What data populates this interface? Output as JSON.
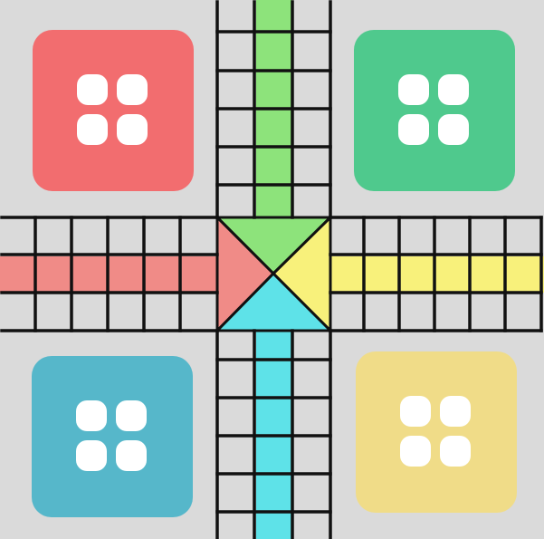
{
  "board": {
    "background": "#dadada",
    "line_color": "#111111",
    "colors": {
      "red": "#f26d6f",
      "green": "#4fc98d",
      "blue": "#56b7ca",
      "yellow": "#f0dc88"
    },
    "lanes": {
      "red": "#f08b87",
      "green": "#8de37b",
      "blue": "#5ee2e8",
      "yellow": "#f8f17b"
    },
    "homes": [
      {
        "color": "red",
        "pawns": 4
      },
      {
        "color": "green",
        "pawns": 4
      },
      {
        "color": "blue",
        "pawns": 4
      },
      {
        "color": "yellow",
        "pawns": 4
      }
    ]
  }
}
